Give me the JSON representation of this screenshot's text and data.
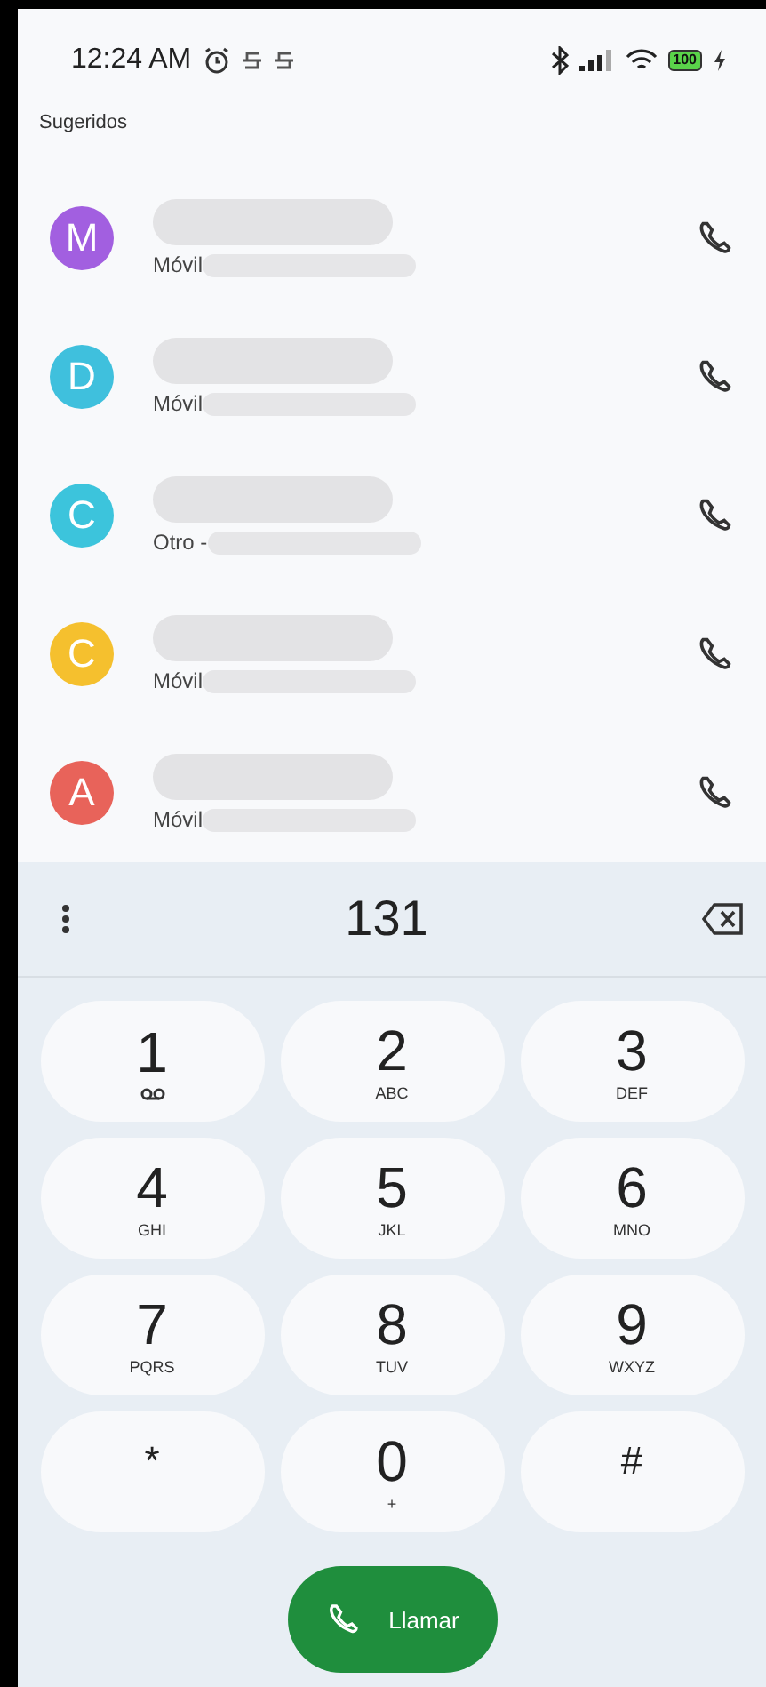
{
  "status_bar": {
    "time": "12:24 AM",
    "battery": "100"
  },
  "section_title": "Sugeridos",
  "contacts": [
    {
      "initial": "M",
      "color": "#a25fe0",
      "label": "Móvil"
    },
    {
      "initial": "D",
      "color": "#3fc0dd",
      "label": "Móvil"
    },
    {
      "initial": "C",
      "color": "#3cc4dc",
      "label": "Otro -"
    },
    {
      "initial": "C",
      "color": "#f5c02e",
      "label": "Móvil"
    },
    {
      "initial": "A",
      "color": "#e8635a",
      "label": "Móvil"
    }
  ],
  "dialed_number": "131",
  "keys": [
    {
      "digit": "1",
      "kind": "voicemail"
    },
    {
      "digit": "2",
      "letters": "ABC",
      "kind": "letters"
    },
    {
      "digit": "3",
      "letters": "DEF",
      "kind": "letters"
    },
    {
      "digit": "4",
      "letters": "GHI",
      "kind": "letters"
    },
    {
      "digit": "5",
      "letters": "JKL",
      "kind": "letters"
    },
    {
      "digit": "6",
      "letters": "MNO",
      "kind": "letters"
    },
    {
      "digit": "7",
      "letters": "PQRS",
      "kind": "letters"
    },
    {
      "digit": "8",
      "letters": "TUV",
      "kind": "letters"
    },
    {
      "digit": "9",
      "letters": "WXYZ",
      "kind": "letters"
    },
    {
      "digit": "*",
      "kind": "symbol"
    },
    {
      "digit": "0",
      "letters": "+",
      "kind": "letters"
    },
    {
      "digit": "#",
      "kind": "symbol"
    }
  ],
  "call_button": "Llamar"
}
